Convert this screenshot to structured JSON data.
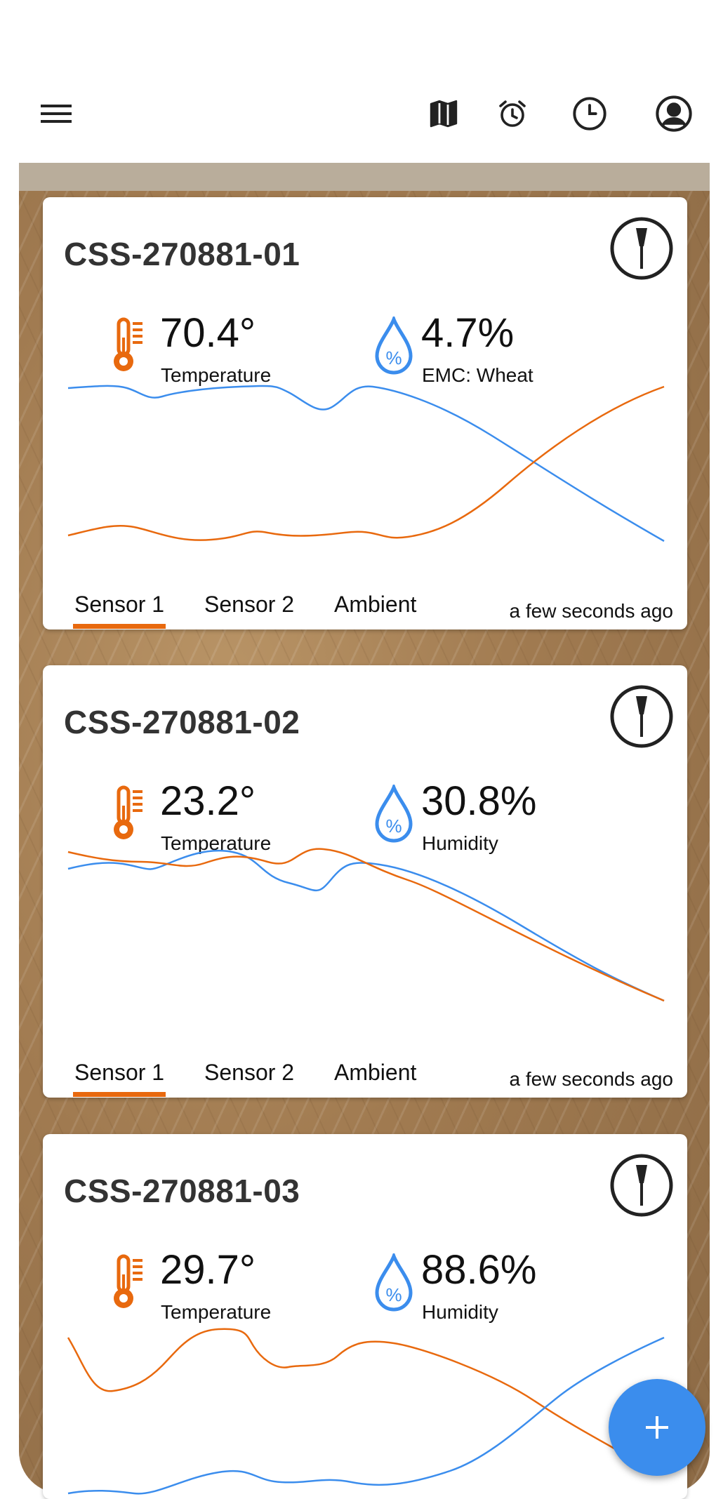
{
  "appbar": {
    "icons": [
      "menu-icon",
      "map-icon",
      "alarm-icon",
      "clock-icon",
      "account-icon"
    ]
  },
  "colors": {
    "accent": "#e8690e",
    "blue": "#3b8ded",
    "title": "#333333"
  },
  "cards": [
    {
      "title": "CSS-270881-01",
      "temperature": "70.4°",
      "temperature_label": "Temperature",
      "humidity": "4.7%",
      "humidity_label": "EMC: Wheat",
      "tabs": [
        "Sensor 1",
        "Sensor 2",
        "Ambient"
      ],
      "active_tab": 0,
      "updated": "a few seconds ago"
    },
    {
      "title": "CSS-270881-02",
      "temperature": "23.2°",
      "temperature_label": "Temperature",
      "humidity": "30.8%",
      "humidity_label": "Humidity",
      "tabs": [
        "Sensor 1",
        "Sensor 2",
        "Ambient"
      ],
      "active_tab": 0,
      "updated": "a few seconds ago"
    },
    {
      "title": "CSS-270881-03",
      "temperature": "29.7°",
      "temperature_label": "Temperature",
      "humidity": "88.6%",
      "humidity_label": "Humidity"
    }
  ],
  "fab": {
    "icon": "plus-icon"
  }
}
